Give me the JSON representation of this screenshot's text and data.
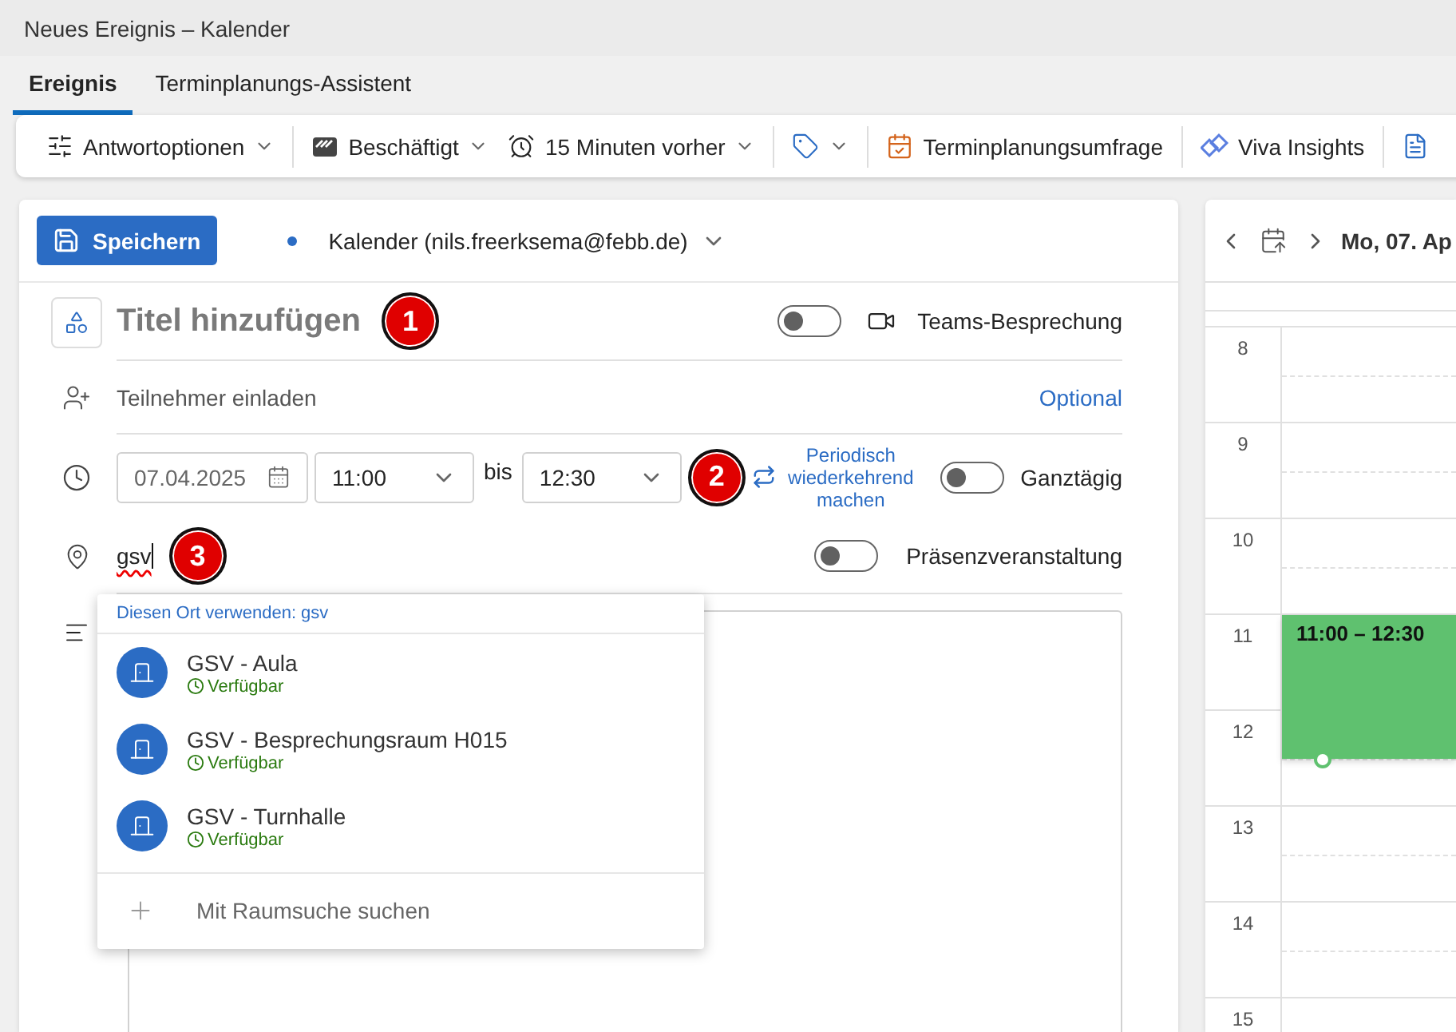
{
  "window": {
    "title": "Neues Ereignis – Kalender"
  },
  "tabs": [
    {
      "label": "Ereignis",
      "selected": true
    },
    {
      "label": "Terminplanungs-Assistent",
      "selected": false
    }
  ],
  "toolbar": [
    {
      "items": [
        {
          "label": "Antwortoptionen",
          "dropdown": true
        }
      ]
    },
    {
      "items": [
        {
          "label": "Beschäftigt",
          "dropdown": true
        },
        {
          "label": "15 Minuten vorher",
          "dropdown": true
        }
      ]
    },
    {
      "items": [
        {
          "dropdown": true
        }
      ]
    },
    {
      "items": [
        {
          "label": "Terminplanungsumfrage",
          "dropdown": false
        }
      ]
    },
    {
      "items": [
        {
          "label": "Viva Insights",
          "dropdown": false
        }
      ]
    },
    {
      "items": [
        {
          "dropdown": false
        }
      ]
    }
  ],
  "save_button": "Speichern",
  "calendar": {
    "label": "Kalender (nils.freerksema@febb.de)"
  },
  "title": {
    "placeholder": "Titel hinzufügen",
    "callout": "1"
  },
  "teams": {
    "label": "Teams-Besprechung",
    "on": false
  },
  "attendees": {
    "placeholder": "Teilnehmer einladen",
    "optional": "Optional"
  },
  "time": {
    "start_date": "07.04.2025",
    "start_time": "11:00",
    "to": "bis",
    "end_time": "12:30",
    "callout": "2",
    "recurrence": "Periodisch wiederkehrend machen"
  },
  "all_day": {
    "label": "Ganztägig",
    "on": false
  },
  "location": {
    "value": "gsv",
    "callout": "3"
  },
  "in_person": {
    "label": "Präsenzveranstaltung",
    "on": false
  },
  "suggestions": {
    "use_location": "Diesen Ort verwenden: gsv",
    "search": "Mit Raumsuche suchen",
    "rooms": [
      {
        "name": "GSV - Aula",
        "status": "Verfügbar"
      },
      {
        "name": "GSV - Besprechungsraum H015",
        "status": "Verfügbar"
      },
      {
        "name": "GSV - Turnhalle",
        "status": "Verfügbar"
      }
    ]
  },
  "calendar_view": {
    "date": "Mo, 07. Ap",
    "hours": [
      {
        "label": "8"
      },
      {
        "label": "9"
      },
      {
        "label": "10"
      },
      {
        "label": "11",
        "event": "11:00 – 12:30"
      },
      {
        "label": "12"
      },
      {
        "label": "13"
      },
      {
        "label": "14"
      },
      {
        "label": "15"
      }
    ]
  }
}
